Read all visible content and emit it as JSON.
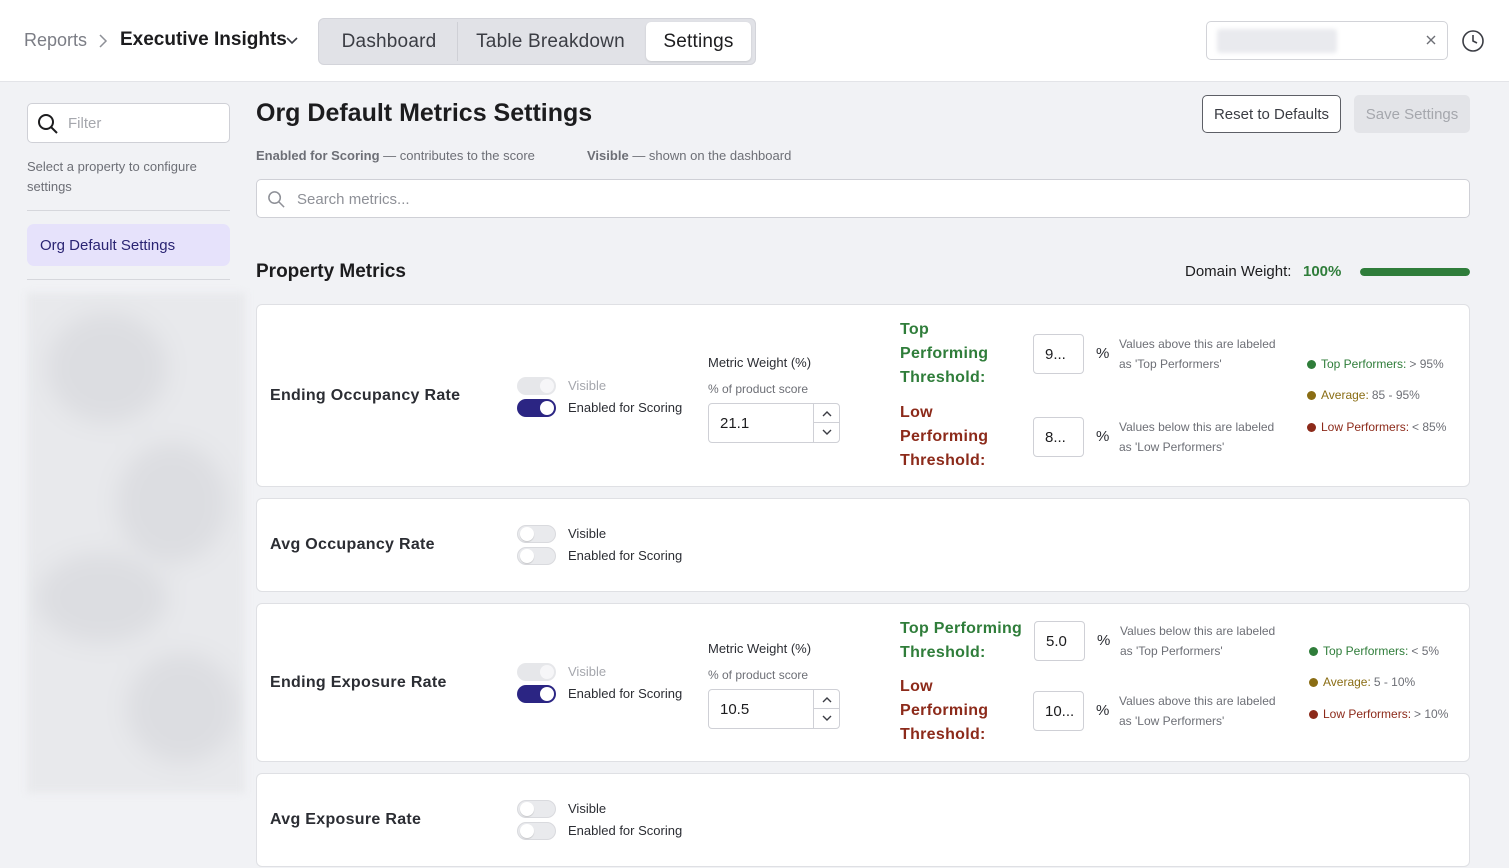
{
  "breadcrumb": {
    "root": "Reports",
    "current": "Executive Insights"
  },
  "tabs": [
    {
      "label": "Dashboard",
      "active": false
    },
    {
      "label": "Table Breakdown",
      "active": false
    },
    {
      "label": "Settings",
      "active": true
    }
  ],
  "sidebar": {
    "filter_placeholder": "Filter",
    "help_text": "Select a property to configure settings",
    "items": [
      {
        "label": "Org Default Settings",
        "selected": true
      }
    ]
  },
  "page": {
    "title": "Org Default Metrics Settings",
    "reset_label": "Reset to Defaults",
    "save_label": "Save Settings",
    "legend_scoring_term": "Enabled for Scoring",
    "legend_scoring_desc": "— contributes to the score",
    "legend_visible_term": "Visible",
    "legend_visible_desc": "— shown on the dashboard",
    "search_placeholder": "Search metrics..."
  },
  "section": {
    "title": "Property Metrics",
    "domain_weight_label": "Domain Weight:",
    "domain_weight_value": "100%",
    "domain_weight_fraction": 1.0
  },
  "labels": {
    "visible": "Visible",
    "enabled_for_scoring": "Enabled for Scoring",
    "metric_weight": "Metric Weight (%)",
    "metric_weight_sub": "% of product score",
    "percent": "%"
  },
  "metrics": [
    {
      "name": "Ending Occupancy Rate",
      "visible": true,
      "scoring": true,
      "weight": "21.1",
      "top_title": "Top Performing Threshold:",
      "top_value": "9...",
      "top_desc": "Values above this are labeled as 'Top Performers'",
      "low_title": "Low Performing Threshold:",
      "low_value": "8...",
      "low_desc": "Values below this are labeled as 'Low Performers'",
      "top_name": "Top Performers:",
      "top_range": "> 95%",
      "avg_name": "Average:",
      "avg_range": "85 - 95%",
      "low_name": "Low Performers:",
      "low_range": "< 85%"
    },
    {
      "name": "Avg Occupancy Rate",
      "visible": false,
      "scoring": false
    },
    {
      "name": "Ending Exposure Rate",
      "visible": true,
      "scoring": true,
      "weight": "10.5",
      "top_title": "Top Performing Threshold:",
      "top_value": "5.0",
      "top_desc": "Values below this are labeled as 'Top Performers'",
      "low_title": "Low Performing Threshold:",
      "low_value": "10...",
      "low_desc": "Values above this are labeled as 'Low Performers'",
      "top_name": "Top Performers:",
      "top_range": "< 5%",
      "avg_name": "Average:",
      "avg_range": "5 - 10%",
      "low_name": "Low Performers:",
      "low_range": "> 10%"
    },
    {
      "name": "Avg Exposure Rate",
      "visible": false,
      "scoring": false
    }
  ],
  "colors": {
    "accent": "#2b2583",
    "top": "#2f7d3a",
    "average": "#8a6d14",
    "low": "#8c2a1a",
    "selected_bg": "#e6e2fb"
  },
  "icons": [
    "chevron-right-icon",
    "chevron-down-icon",
    "close-icon",
    "clock-icon",
    "search-icon",
    "chevron-up-icon"
  ]
}
